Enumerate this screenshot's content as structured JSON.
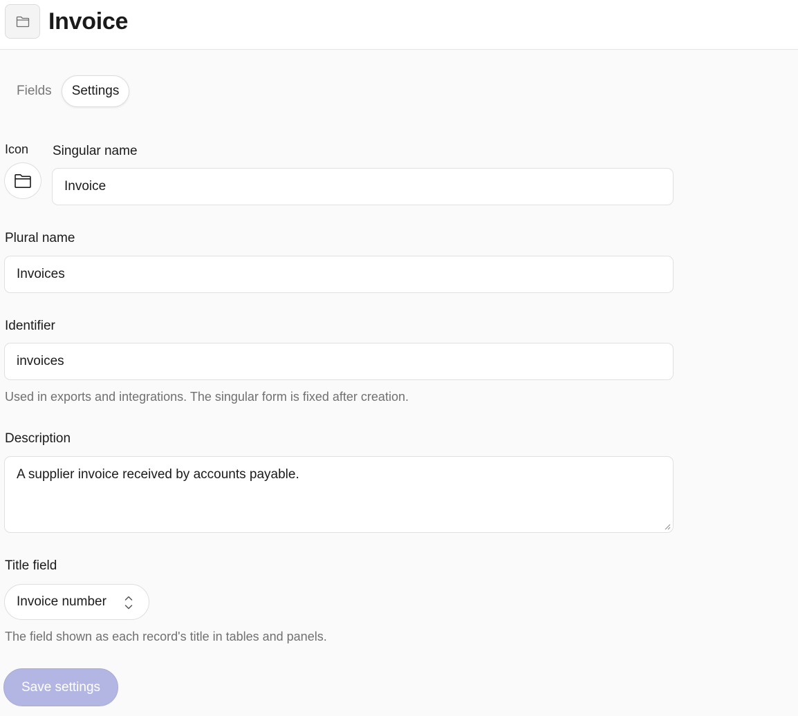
{
  "header": {
    "title": "Invoice",
    "icon": "folder-icon"
  },
  "tabs": [
    {
      "label": "Fields",
      "active": false
    },
    {
      "label": "Settings",
      "active": true
    }
  ],
  "form": {
    "icon_label": "Icon",
    "icon_value": "folder-icon",
    "singular_label": "Singular name",
    "singular_value": "Invoice",
    "plural_label": "Plural name",
    "plural_value": "Invoices",
    "identifier_label": "Identifier",
    "identifier_value": "invoices",
    "identifier_help": "Used in exports and integrations. The singular form is fixed after creation.",
    "description_label": "Description",
    "description_value": "A supplier invoice received by accounts payable.",
    "title_field_label": "Title field",
    "title_field_value": "Invoice number",
    "title_field_help": "The field shown as each record's title in tables and panels.",
    "save_label": "Save settings"
  },
  "colors": {
    "save_button_bg": "#b3b6e3",
    "page_bg": "#fafafa"
  }
}
